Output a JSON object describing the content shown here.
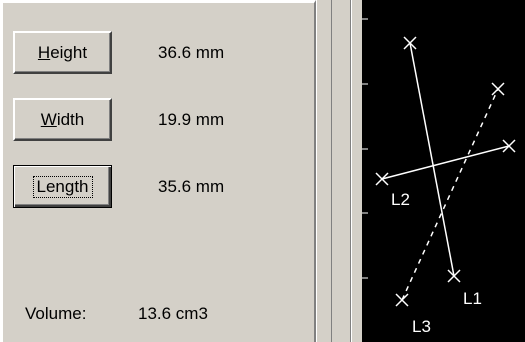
{
  "measurements": {
    "height": {
      "label_accel": "H",
      "label_rest": "eight",
      "value": "36.6 mm"
    },
    "width": {
      "label_accel": "W",
      "label_rest": "idth",
      "value": "19.9 mm"
    },
    "length": {
      "label_accel": "",
      "label_rest": "Length",
      "value": "35.6 mm"
    }
  },
  "volume": {
    "label": "Volume:",
    "value": "13.6 cm3"
  },
  "viewer": {
    "lines": [
      {
        "name": "L1",
        "style": "solid"
      },
      {
        "name": "L2",
        "style": "solid"
      },
      {
        "name": "L3",
        "style": "dashed"
      }
    ],
    "colors": {
      "background": "#000000",
      "lines": "#ffffff"
    }
  }
}
